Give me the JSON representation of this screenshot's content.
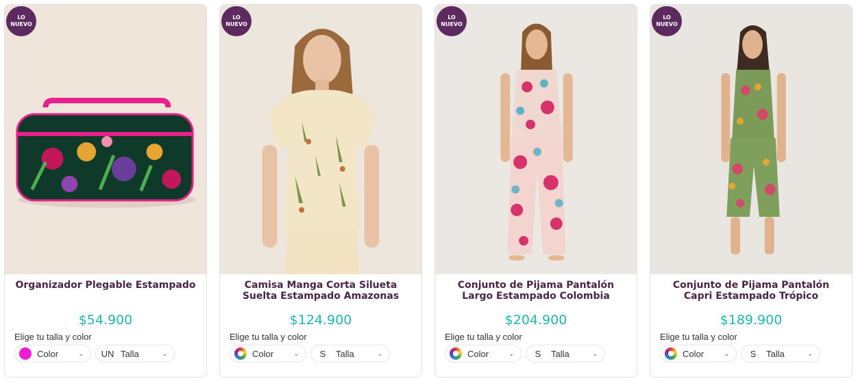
{
  "products": [
    {
      "badge_line1": "LO",
      "badge_line2": "NUEVO",
      "title": "Organizador Plegable Estampado",
      "price": "$54.900",
      "choose_label": "Elige tu talla y color",
      "color_label": "Color",
      "size_code": "UN",
      "size_label": "Talla",
      "swatch": "#f01bd2"
    },
    {
      "badge_line1": "LO",
      "badge_line2": "NUEVO",
      "title": "Camisa Manga Corta Silueta Suelta Estampado Amazonas",
      "price": "$124.900",
      "choose_label": "Elige tu talla y color",
      "color_label": "Color",
      "size_code": "S",
      "size_label": "Talla"
    },
    {
      "badge_line1": "LO",
      "badge_line2": "NUEVO",
      "title": "Conjunto de Pijama Pantalón Largo Estampado Colombia",
      "price": "$204.900",
      "choose_label": "Elige tu talla y color",
      "color_label": "Color",
      "size_code": "S",
      "size_label": "Talla"
    },
    {
      "badge_line1": "LO",
      "badge_line2": "NUEVO",
      "title": "Conjunto de Pijama Pantalón Capri Estampado Trópico",
      "price": "$189.900",
      "choose_label": "Elige tu talla y color",
      "color_label": "Color",
      "size_code": "S",
      "size_label": "Talla"
    }
  ],
  "colors": {
    "badge": "#5c2a5e",
    "title": "#4a2447",
    "price": "#1fb8a6"
  },
  "icons": {
    "dropdown": "chevron-down-icon",
    "multicolor": "multicolor-swatch-icon"
  }
}
